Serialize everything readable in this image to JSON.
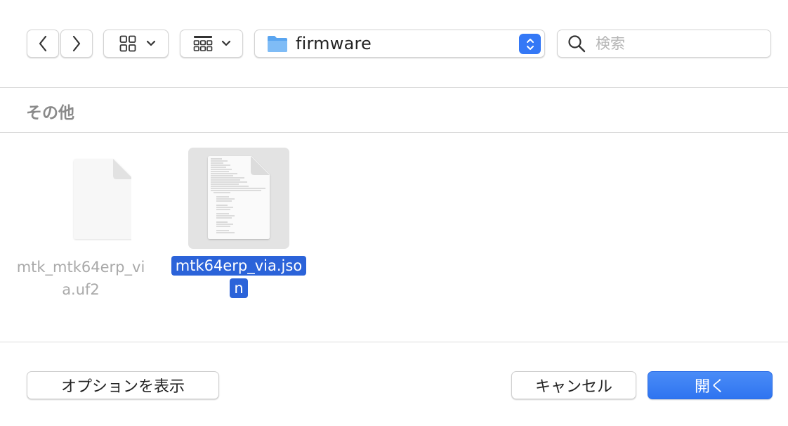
{
  "toolbar": {
    "back_icon": "chevron-left-icon",
    "forward_icon": "chevron-right-icon",
    "view_icon": "grid-view-icon",
    "group_icon": "group-by-icon",
    "path": "firmware",
    "path_icon": "folder-icon",
    "accent_color": "#3478f6"
  },
  "search": {
    "placeholder": "検索",
    "value": ""
  },
  "section": {
    "title": "その他"
  },
  "files": [
    {
      "name": "mtk_mtk64erp_via.uf2",
      "line1": "mtk_mtk64erp_vi",
      "line2": "a.uf2",
      "selected": false,
      "icon": "generic-document-icon"
    },
    {
      "name": "mtk64erp_via.json",
      "line1": "mtk64erp_via.jso",
      "line2": "n",
      "selected": true,
      "icon": "document-preview-icon"
    }
  ],
  "footer": {
    "options_label": "オプションを表示",
    "cancel_label": "キャンセル",
    "open_label": "開く"
  }
}
